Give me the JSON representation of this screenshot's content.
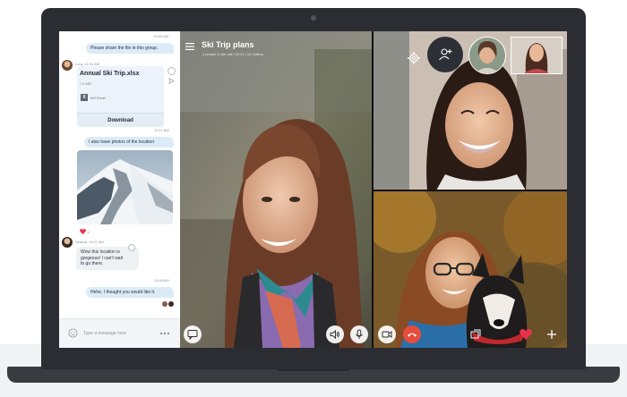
{
  "chat": {
    "messages": {
      "m1": {
        "time": "10:59 AM",
        "text": "Please share the file in this group."
      },
      "m2": {
        "sender": "Lucy, 11:00 AM",
        "file_name": "Annual Ski Trip.xlsx",
        "file_size": "7.6 MB",
        "file_type": "MS Excel",
        "download_label": "Download"
      },
      "m3": {
        "time": "11:07 AM",
        "text": "I also have photos of the location"
      },
      "m4": {
        "reaction_count": "1",
        "sender": "Serena, 11:07 AM",
        "text_line1": "Wow this location is",
        "text_line2": "gorgeous! I can't wait",
        "text_line3": "to go there."
      },
      "m5": {
        "time": "11:08 AM",
        "text": "Hehe, I thought you would like it."
      }
    },
    "composer": {
      "placeholder": "Type a message here"
    }
  },
  "call": {
    "title": "Ski Trip plans",
    "subtitle": "3 people in the call | 02:21 | 10 Gallery"
  },
  "icons": {
    "menu": "hamburger-menu-icon",
    "settings": "gear-icon",
    "add_person": "add-person-icon",
    "chat_toggle": "chat-icon",
    "speaker": "speaker-icon",
    "mic": "microphone-icon",
    "video": "video-camera-icon",
    "end_call": "end-call-icon",
    "share": "screen-share-icon",
    "heart": "heart-icon",
    "plus": "plus-icon",
    "emoji": "emoji-icon",
    "more": "more-dots-icon"
  },
  "colors": {
    "end_call": "#e74c3c",
    "heart": "#e8324a",
    "accent": "#1a86d8",
    "outgoing_bubble": "#dcebf8"
  }
}
